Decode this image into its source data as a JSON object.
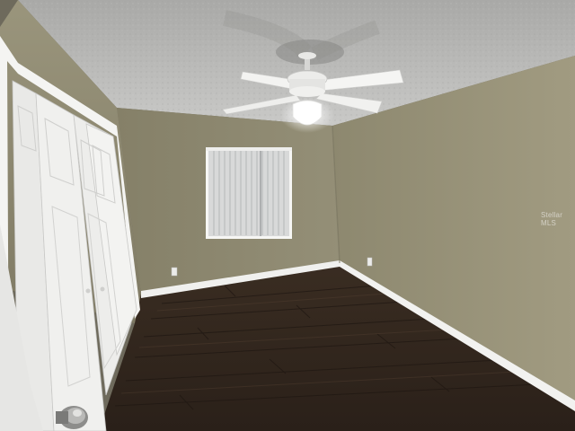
{
  "scene": {
    "description_tags": [
      "empty-bedroom",
      "ceiling-fan",
      "window-blinds",
      "closet-bifold-doors",
      "dark-wood-floor"
    ],
    "watermark_text": "Stellar MLS"
  },
  "colors": {
    "ceiling": "#b9b9b7",
    "wall_back": "#8f8a72",
    "wall_right": "#9a9479",
    "wall_left": "#8c876f",
    "floor": "#2f241c",
    "trim": "#f2f2f0",
    "door": "#ececea",
    "blinds": "#dcdddd"
  }
}
